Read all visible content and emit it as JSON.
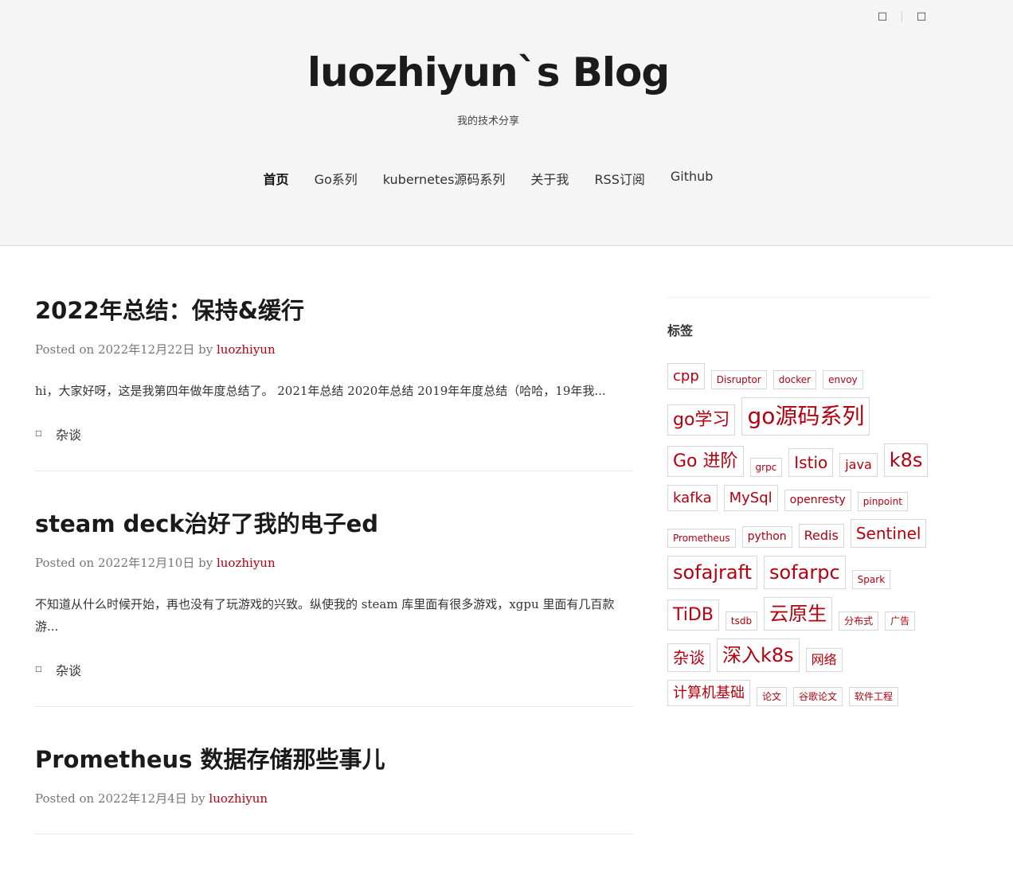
{
  "header": {
    "title": "luozhiyun`s Blog",
    "description": "我的技术分享",
    "icons": [
      "search-icon",
      "menu-icon"
    ],
    "nav": [
      {
        "label": "首页",
        "active": true
      },
      {
        "label": "Go系列"
      },
      {
        "label": "kubernetes源码系列"
      },
      {
        "label": "关于我"
      },
      {
        "label": "RSS订阅"
      },
      {
        "label": "Github"
      }
    ]
  },
  "posts": [
    {
      "title": "2022年总结：保持&缓行",
      "posted_prefix": "Posted on",
      "date": "2022年12月22日",
      "by": "by",
      "author": "luozhiyun",
      "excerpt": "hi，大家好呀，这是我第四年做年度总结了。 2021年总结 2020年总结 2019年年度总结（哈哈，19年我...",
      "category": "杂谈"
    },
    {
      "title": "steam deck治好了我的电子ed",
      "posted_prefix": "Posted on",
      "date": "2022年12月10日",
      "by": "by",
      "author": "luozhiyun",
      "excerpt": "不知道从什么时候开始，再也没有了玩游戏的兴致。纵使我的 steam 库里面有很多游戏，xgpu 里面有几百款游...",
      "category": "杂谈"
    },
    {
      "title": "Prometheus 数据存储那些事儿",
      "posted_prefix": "Posted on",
      "date": "2022年12月4日",
      "by": "by",
      "author": "luozhiyun"
    }
  ],
  "sidebar": {
    "widget_title": "标签",
    "tags": [
      "cpp",
      "Disruptor",
      "docker",
      "envoy",
      "go学习",
      "go源码系列",
      "Go 进阶",
      "grpc",
      "Istio",
      "java",
      "k8s",
      "kafka",
      "MySql",
      "openresty",
      "pinpoint",
      "Prometheus",
      "python",
      "Redis",
      "Sentinel",
      "sofajraft",
      "sofarpc",
      "Spark",
      "TiDB",
      "tsdb",
      "云原生",
      "分布式",
      "广告",
      "杂谈",
      "深入k8s",
      "网络",
      "计算机基础",
      "论文",
      "谷歌论文",
      "软件工程"
    ]
  },
  "colors": {
    "accent": "#b4000f",
    "header_bg": "#f5f5f5"
  }
}
